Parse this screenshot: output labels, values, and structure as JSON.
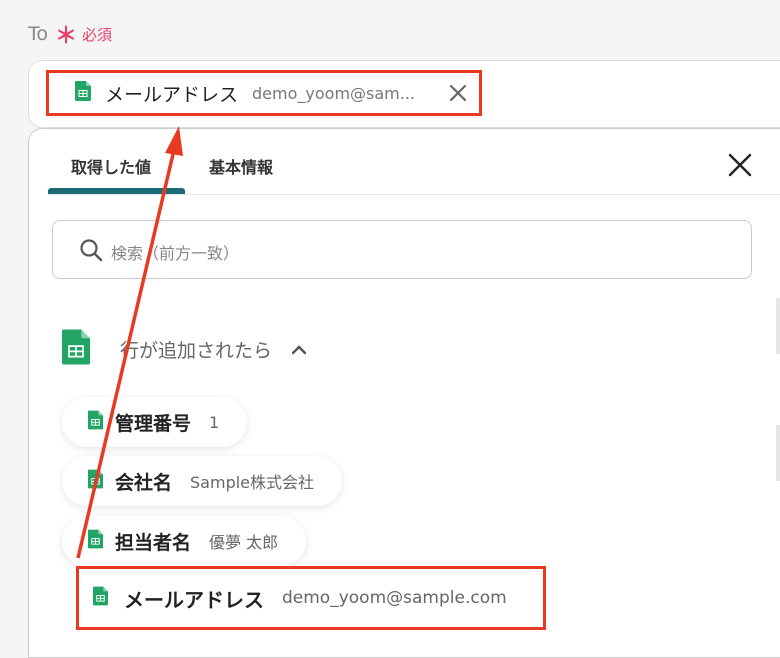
{
  "field": {
    "label": "To",
    "required_star": "＊",
    "required_text": "必須"
  },
  "selected_chip": {
    "icon": "google-sheets-icon",
    "label": "メールアドレス",
    "value": "demo_yoom@sam..."
  },
  "panel": {
    "tabs": [
      {
        "label": "取得した値",
        "active": true
      },
      {
        "label": "基本情報",
        "active": false
      }
    ],
    "search_placeholder": "検索（前方一致）",
    "group": {
      "icon": "google-sheets-icon",
      "label": "行が追加されたら",
      "expanded": true
    },
    "variables": [
      {
        "name": "管理番号",
        "value": "1"
      },
      {
        "name": "会社名",
        "value": "Sample株式会社"
      },
      {
        "name": "担当者名",
        "value": "優夢 太郎"
      },
      {
        "name": "メールアドレス",
        "value": "demo_yoom@sample.com",
        "highlighted": true
      }
    ]
  },
  "colors": {
    "accent": "#1c6a77",
    "highlight": "#e83a23",
    "required": "#e8416b",
    "sheets_green": "#21a464"
  }
}
